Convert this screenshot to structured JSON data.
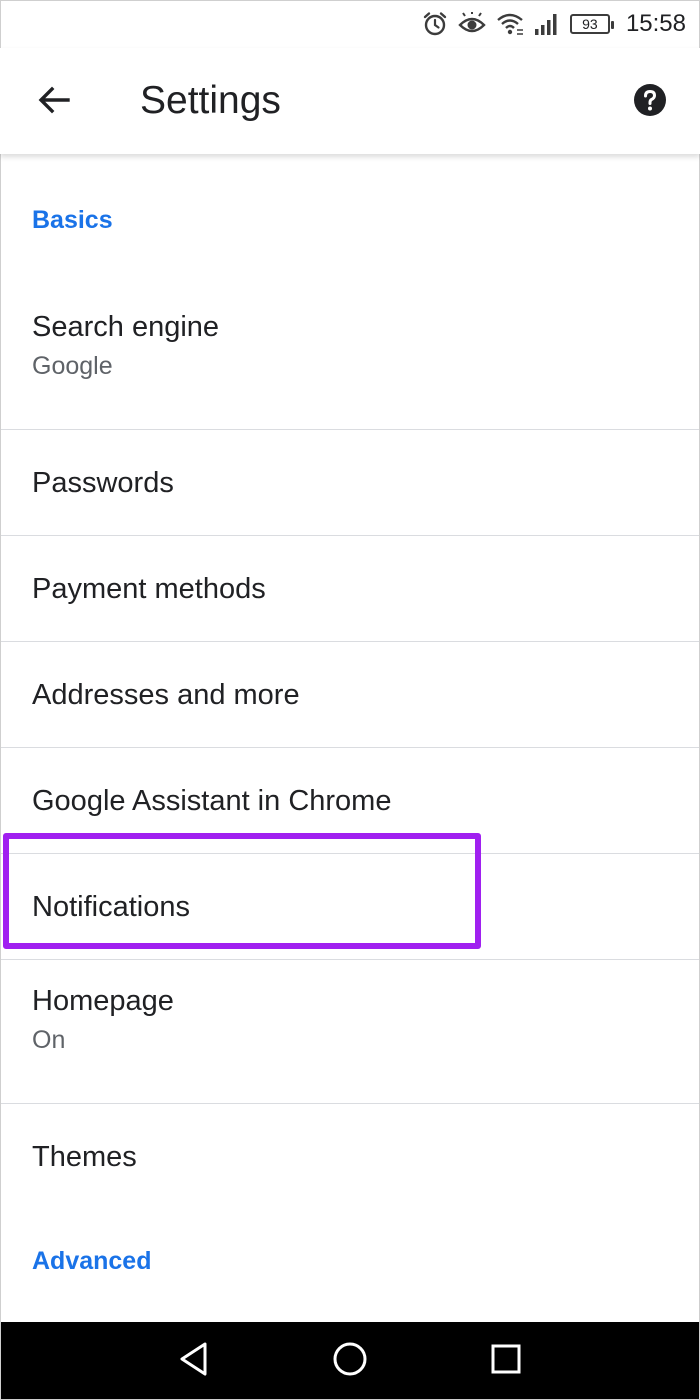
{
  "status_bar": {
    "icons": [
      "alarm-icon",
      "eye-comfort-icon",
      "wifi-icon",
      "signal-icon"
    ],
    "battery_level": "93",
    "time": "15:58"
  },
  "toolbar": {
    "back_icon": "arrow-back-icon",
    "title": "Settings",
    "help_icon": "help-icon"
  },
  "sections": {
    "basics_label": "Basics",
    "advanced_label": "Advanced"
  },
  "items": [
    {
      "title": "Search engine",
      "subtitle": "Google"
    },
    {
      "title": "Passwords"
    },
    {
      "title": "Payment methods"
    },
    {
      "title": "Addresses and more"
    },
    {
      "title": "Google Assistant in Chrome"
    },
    {
      "title": "Notifications",
      "highlighted": true
    },
    {
      "title": "Homepage",
      "subtitle": "On"
    },
    {
      "title": "Themes"
    }
  ],
  "colors": {
    "accent": "#1a73e8",
    "highlight_border": "#a020f0",
    "nav_bar": "#000000"
  },
  "nav_bar": {
    "icons": [
      "back-triangle-icon",
      "home-circle-icon",
      "recents-square-icon"
    ]
  }
}
